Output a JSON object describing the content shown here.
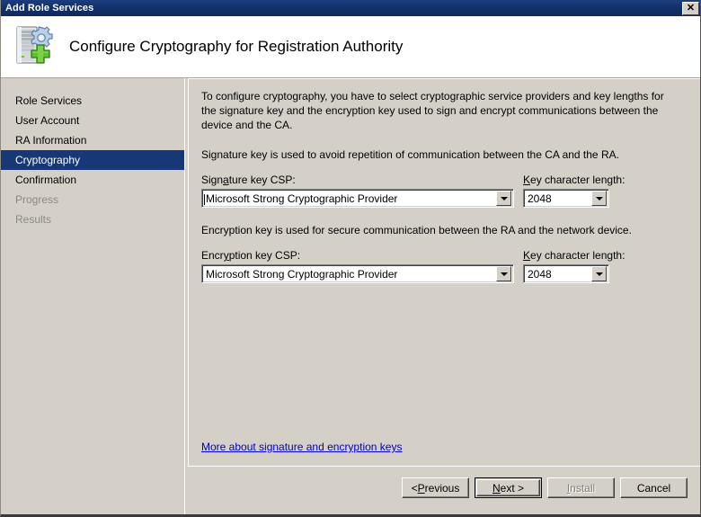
{
  "window": {
    "title": "Add Role Services",
    "close_label": "✕"
  },
  "header": {
    "title": "Configure Cryptography for Registration Authority",
    "icon": "server-gear-add-icon"
  },
  "sidebar": {
    "items": [
      {
        "label": "Role Services",
        "state": "normal"
      },
      {
        "label": "User Account",
        "state": "normal"
      },
      {
        "label": "RA Information",
        "state": "normal"
      },
      {
        "label": "Cryptography",
        "state": "selected"
      },
      {
        "label": "Confirmation",
        "state": "normal"
      },
      {
        "label": "Progress",
        "state": "disabled"
      },
      {
        "label": "Results",
        "state": "disabled"
      }
    ],
    "selected_color": "#173776",
    "disabled_color": "#8b8882"
  },
  "main": {
    "intro_paragraph": "To configure cryptography, you have to select cryptographic service providers and key lengths for the signature key and the encryption key used to sign and encrypt communications between the device and the CA.",
    "signature_description": "Signature key is used to avoid repetition of communication between the CA and the RA.",
    "encryption_description": "Encryption key is used for secure communication between the RA and the network device.",
    "signature": {
      "csp_label_pre": "Sign",
      "csp_label_accel": "a",
      "csp_label_post": "ture key CSP:",
      "csp_value": "Microsoft Strong Cryptographic Provider",
      "length_label_accel": "K",
      "length_label_post": "ey character length:",
      "length_value": "2048"
    },
    "encryption": {
      "csp_label_pre": "Encr",
      "csp_label_accel": "y",
      "csp_label_post": "ption key CSP:",
      "csp_value": "Microsoft Strong Cryptographic Provider",
      "length_label_accel": "K",
      "length_label_post": "ey character length:",
      "length_value": "2048"
    },
    "help_link": "More about signature and encryption keys",
    "link_color": "#0000cd"
  },
  "footer": {
    "buttons": [
      {
        "pre": "< ",
        "accel": "P",
        "post": "revious",
        "state": "enabled"
      },
      {
        "pre": "",
        "accel": "N",
        "post": "ext >",
        "state": "default"
      },
      {
        "pre": "",
        "accel": "I",
        "post": "nstall",
        "state": "disabled"
      },
      {
        "pre": "",
        "accel": "",
        "post": "Cancel",
        "state": "enabled"
      }
    ]
  }
}
